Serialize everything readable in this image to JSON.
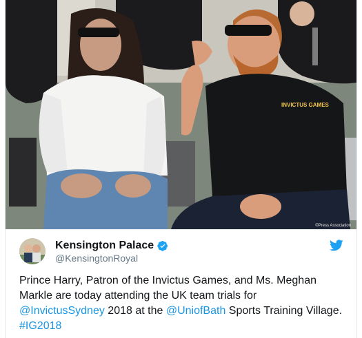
{
  "photo": {
    "alt": "",
    "credit": "©Press Association",
    "shirt_logo": "INVICTUS GAMES"
  },
  "account": {
    "name": "Kensington Palace",
    "handle": "@KensingtonRoyal",
    "verified": true
  },
  "tweet": {
    "segments": [
      {
        "text": "Prince Harry, Patron of the Invictus Games, and Ms. Meghan Markle are today attending the UK team trials for ",
        "type": "text"
      },
      {
        "text": "@InvictusSydney",
        "type": "link"
      },
      {
        "text": " 2018 at the ",
        "type": "text"
      },
      {
        "text": "@UniofBath",
        "type": "link"
      },
      {
        "text": " Sports Training Village. ",
        "type": "text"
      },
      {
        "text": "#IG2018",
        "type": "link"
      }
    ]
  },
  "icons": {
    "verified": "verified-badge-icon",
    "twitter": "twitter-bird-icon"
  },
  "colors": {
    "link": "#1b95e0",
    "verified": "#1da1f2",
    "text": "#14171a",
    "muted": "#657786"
  }
}
